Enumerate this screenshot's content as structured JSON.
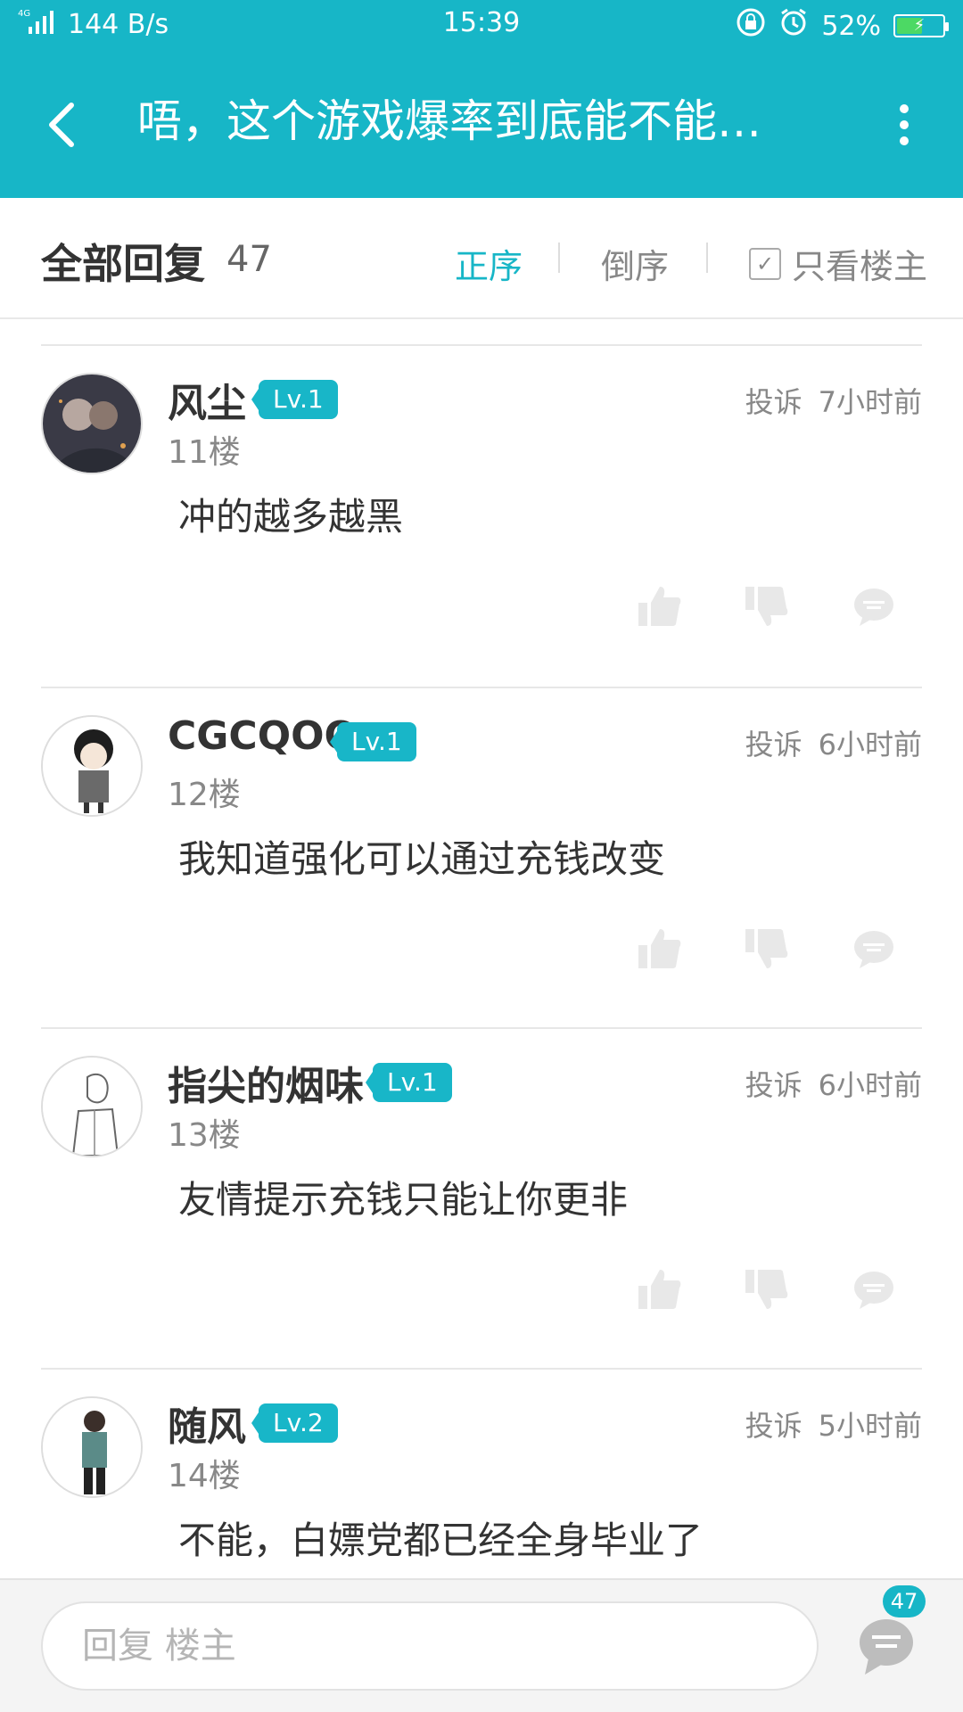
{
  "status_bar": {
    "network_type": "4G",
    "speed": "144 B/s",
    "time": "15:39",
    "battery": "52%",
    "icons": [
      "signal-icon",
      "lock-rotate-icon",
      "alarm-icon",
      "battery-icon"
    ]
  },
  "nav": {
    "title": "唔，这个游戏爆率到底能不能…"
  },
  "replies_header": {
    "title": "全部回复",
    "count": "47",
    "sort_asc": "正序",
    "sort_desc": "倒序",
    "only_op": "只看楼主",
    "active_color": "#17b6c7"
  },
  "replies": [
    {
      "name": "风尘",
      "level": "Lv.1",
      "floor": "11楼",
      "report": "投诉",
      "time": "7小时前",
      "content": "冲的越多越黑"
    },
    {
      "name": "CGCQOO",
      "level": "Lv.1",
      "floor": "12楼",
      "report": "投诉",
      "time": "6小时前",
      "content": "我知道强化可以通过充钱改变"
    },
    {
      "name": "指尖的烟味",
      "level": "Lv.1",
      "floor": "13楼",
      "report": "投诉",
      "time": "6小时前",
      "content": "友情提示充钱只能让你更非"
    },
    {
      "name": "随风",
      "level": "Lv.2",
      "floor": "14楼",
      "report": "投诉",
      "time": "5小时前",
      "content": "不能，白嫖党都已经全身毕业了"
    }
  ],
  "bottom_bar": {
    "input_placeholder": "回复  楼主",
    "comment_count": "47"
  },
  "colors": {
    "brand": "#17b6c7",
    "level_badge": "#18b6c8"
  }
}
